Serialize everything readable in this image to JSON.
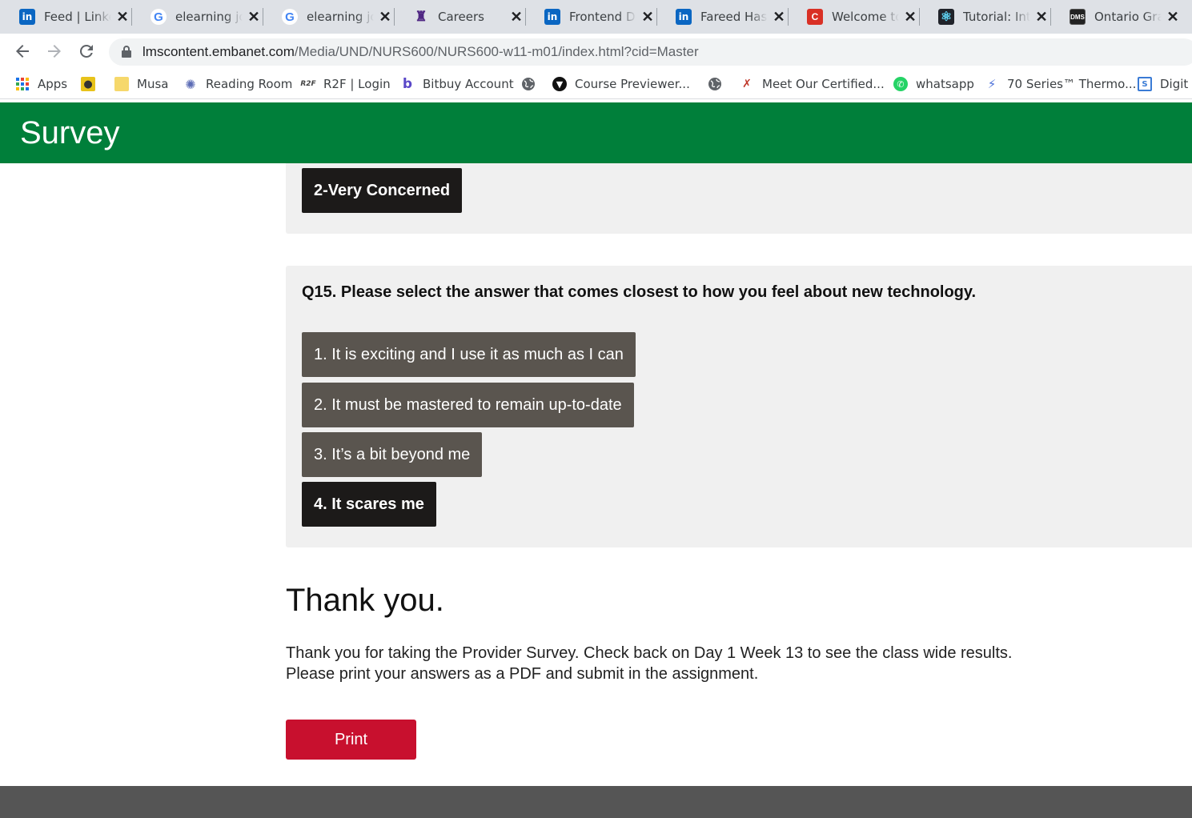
{
  "browser": {
    "tabs": [
      {
        "title": "Feed | LinkedIn",
        "icon": "linkedin-icon"
      },
      {
        "title": "elearning jobs",
        "icon": "google-icon"
      },
      {
        "title": "elearning jobs",
        "icon": "google-icon"
      },
      {
        "title": "Careers",
        "icon": "western-crest-icon"
      },
      {
        "title": "Frontend Developer",
        "icon": "linkedin-icon"
      },
      {
        "title": "Fareed Hassan",
        "icon": "linkedin-icon"
      },
      {
        "title": "Welcome to",
        "icon": "red-c-icon"
      },
      {
        "title": "Tutorial: Intro",
        "icon": "react-icon"
      },
      {
        "title": "Ontario Grants",
        "icon": "dms-icon"
      }
    ],
    "tab_close_glyph": "✕",
    "url_host": "lmscontent.embanet.com",
    "url_path": "/Media/UND/NURS600/NURS600-w11-m01/index.html?cid=Master",
    "bookmarks": [
      {
        "label": "Apps",
        "icon": "apps-grid-icon"
      },
      {
        "label": "",
        "icon": "eye-bookmark-icon"
      },
      {
        "label": "Musa",
        "icon": "folder-icon"
      },
      {
        "label": "Reading Room",
        "icon": "sun-icon"
      },
      {
        "label": "R2F | Login",
        "icon": "r2f-icon"
      },
      {
        "label": "Bitbuy Account",
        "icon": "bitbuy-icon"
      },
      {
        "label": "",
        "icon": "globe-icon"
      },
      {
        "label": "Course Previewer...",
        "icon": "brave-icon"
      },
      {
        "label": "",
        "icon": "globe-icon"
      },
      {
        "label": "Meet Our Certified...",
        "icon": "certified-icon"
      },
      {
        "label": "whatsapp",
        "icon": "whatsapp-icon"
      },
      {
        "label": "70 Series™ Thermo...",
        "icon": "thermo-icon"
      },
      {
        "label": "Digit",
        "icon": "digit-icon"
      }
    ]
  },
  "survey": {
    "title": "Survey",
    "previous_selected_answer": "2-Very Concerned",
    "q15": {
      "question": "Q15. Please select the answer that comes closest to how you feel about new technology.",
      "options": [
        {
          "label": "1. It is exciting and I use it as much as I can",
          "selected": false
        },
        {
          "label": "2. It must be mastered to remain up-to-date",
          "selected": false
        },
        {
          "label": "3. It’s a bit beyond me",
          "selected": false
        },
        {
          "label": "4. It scares me",
          "selected": true
        }
      ]
    },
    "thank_you_title": "Thank you.",
    "thank_you_line1": "Thank you for taking the Provider Survey. Check back on Day 1 Week 13 to see the class wide results.",
    "thank_you_line2": "Please print your answers as a PDF and submit in the assignment.",
    "print_label": "Print"
  },
  "colors": {
    "header_green": "#007f3a",
    "print_red": "#c8102e",
    "option_default": "#5a554f",
    "option_selected": "#1c1a19"
  }
}
